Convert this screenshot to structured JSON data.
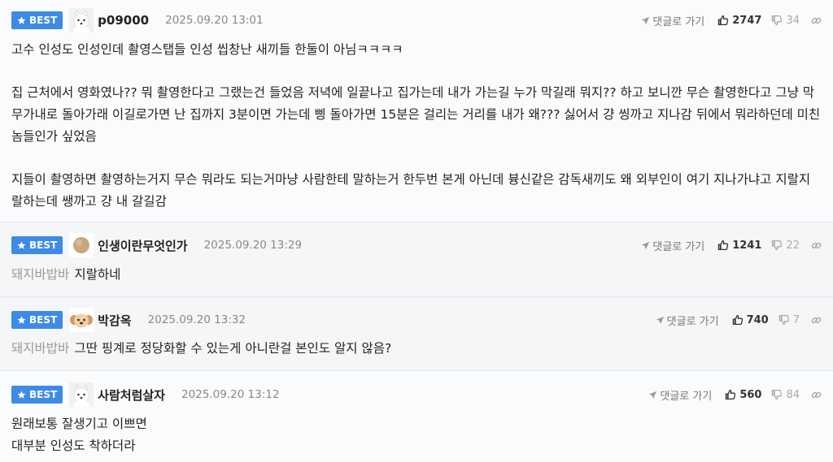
{
  "badge_label": "BEST",
  "reply_label": "댓글로 가기",
  "comments": [
    {
      "nick": "p09000",
      "date": "2025.09.20 13:01",
      "likes": "2747",
      "dislikes": "34",
      "paragraphs": [
        "고수 인성도 인성인데 촬영스탭들 인성 씹창난 새끼들 한둘이 아님ㅋㅋㅋㅋ",
        "집 근처에서 영화였나?? 뭐 촬영한다고 그랬는건 들었음 저녁에 일끝나고 집가는데 내가 가는길 누가 막길래 뭐지?? 하고 보니깐 무슨 촬영한다고 그냥 막무가내로 돌아가래 이길로가면 난 집까지 3분이면 가는데 삥 돌아가면 15분은 걸리는 거리를 내가 왜??? 싫어서 걍 씽까고 지나감 뒤에서 뭐라하던데 미친놈들인가 싶었음",
        "지들이 촬영하면 촬영하는거지 무슨 뭐라도 되는거마냥 사람한테 말하는거 한두번 본게 아닌데 븅신같은 감독새끼도 왜 외부인이 여기 지나가냐고 지랄지랄하는데 쌩까고 걍 내 갈길감"
      ]
    },
    {
      "nick": "인생이란무엇인가",
      "date": "2025.09.20 13:29",
      "likes": "1241",
      "dislikes": "22",
      "reply_to": "돼지바밥바",
      "text": "지랄하네"
    },
    {
      "nick": "박감옥",
      "date": "2025.09.20 13:32",
      "likes": "740",
      "dislikes": "7",
      "reply_to": "돼지바밥바",
      "text": "그딴 핑계로 정당화할 수 있는게 아니란걸 본인도 알지 않음?"
    },
    {
      "nick": "사람처럼살자",
      "date": "2025.09.20 13:12",
      "likes": "560",
      "dislikes": "84",
      "lines": [
        "원래보통 잘생기고 이쁘면",
        "대부분 인성도 착하더라"
      ]
    }
  ],
  "colors": {
    "badge": "#3d8be6",
    "muted": "#888888",
    "reply_to": "#999999"
  },
  "icons": [
    "star-icon",
    "send-icon",
    "thumbs-up-icon",
    "thumbs-down-icon",
    "link-icon",
    "avatar-dog-icon",
    "avatar-ball-icon"
  ]
}
